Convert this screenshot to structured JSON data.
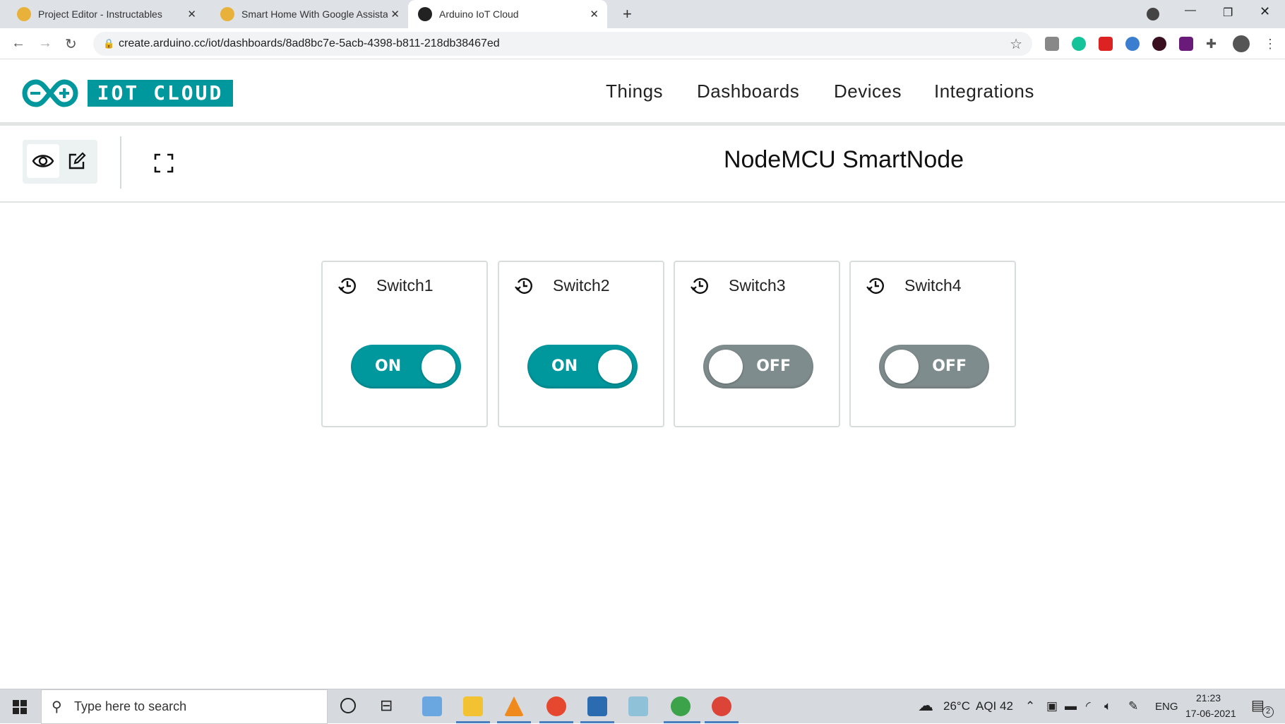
{
  "browser": {
    "tabs": [
      {
        "title": "Project Editor - Instructables",
        "active": false
      },
      {
        "title": "Smart Home With Google Assista",
        "active": false
      },
      {
        "title": "Arduino IoT Cloud",
        "active": true
      }
    ],
    "url": "create.arduino.cc/iot/dashboards/8ad8bc7e-5acb-4398-b811-218db38467ed"
  },
  "app": {
    "logo_text": "IOT CLOUD",
    "nav": [
      "Things",
      "Dashboards",
      "Devices",
      "Integrations"
    ],
    "dashboard_title": "NodeMCU SmartNode",
    "accent_color": "#00979d",
    "off_color": "#7f8c8d"
  },
  "widgets": [
    {
      "label": "Switch1",
      "state": "ON"
    },
    {
      "label": "Switch2",
      "state": "ON"
    },
    {
      "label": "Switch3",
      "state": "OFF"
    },
    {
      "label": "Switch4",
      "state": "OFF"
    }
  ],
  "taskbar": {
    "search_placeholder": "Type here to search",
    "weather": "26°C",
    "aqi": "AQI 42",
    "language": "ENG",
    "time": "21:23",
    "date": "17-06-2021",
    "notifications": "2"
  }
}
